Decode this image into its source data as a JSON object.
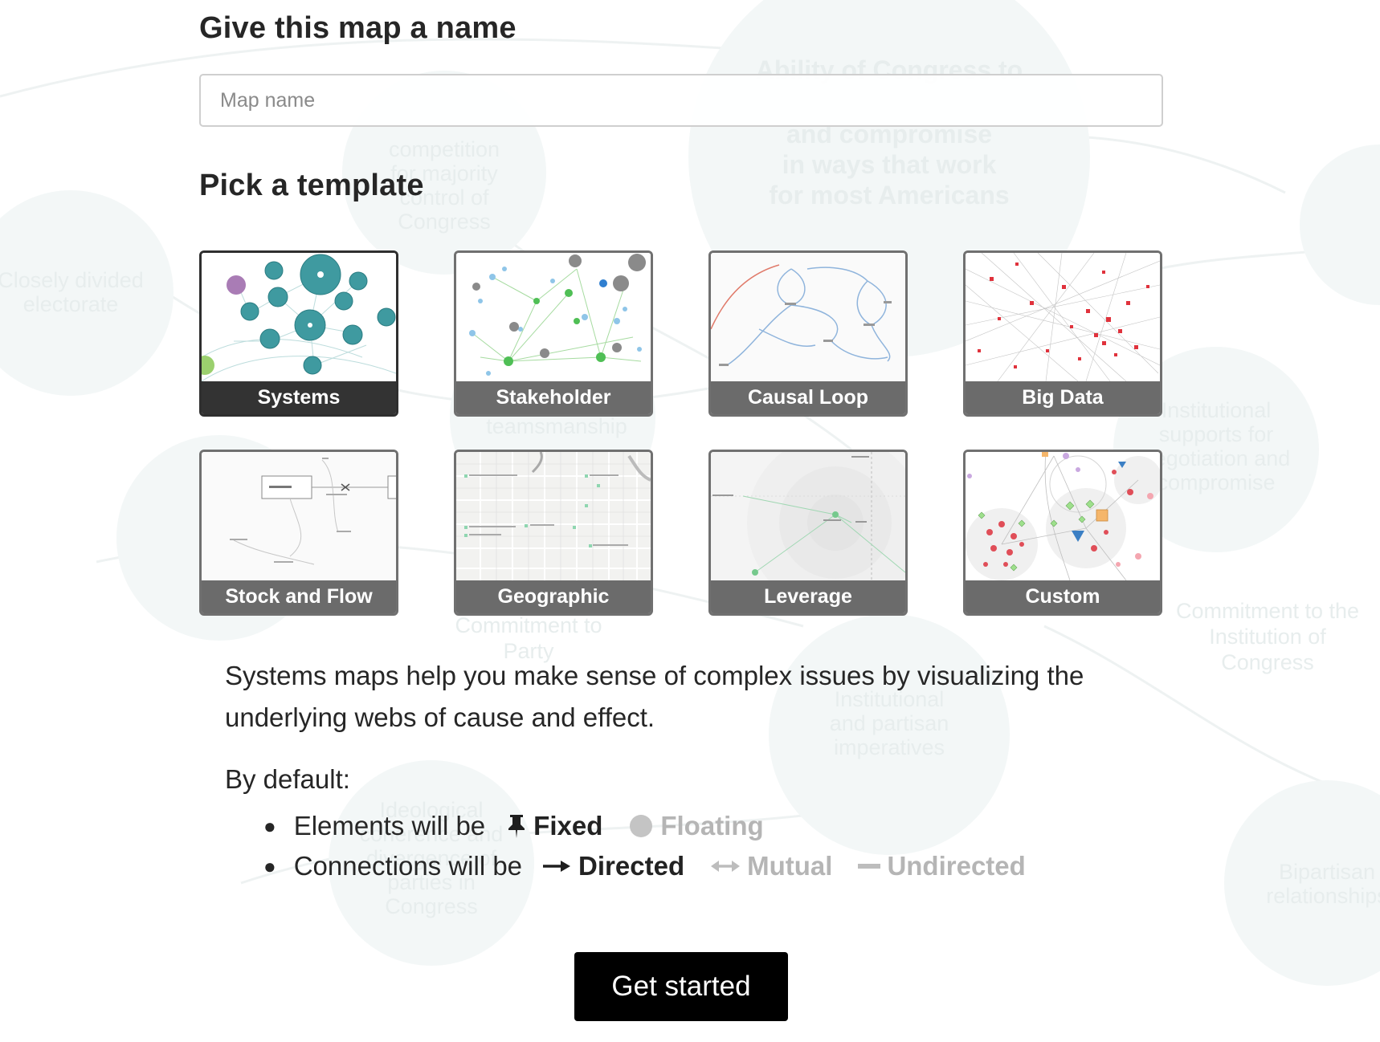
{
  "name_section": {
    "title": "Give this map a name",
    "input_placeholder": "Map name",
    "input_value": ""
  },
  "template_section": {
    "title": "Pick a template",
    "selected": "Systems",
    "templates": [
      {
        "label": "Systems"
      },
      {
        "label": "Stakeholder"
      },
      {
        "label": "Causal Loop"
      },
      {
        "label": "Big Data"
      },
      {
        "label": "Stock and Flow"
      },
      {
        "label": "Geographic"
      },
      {
        "label": "Leverage"
      },
      {
        "label": "Custom"
      }
    ]
  },
  "description": "Systems maps help you make sense of complex issues by visualizing the underlying webs of cause and effect.",
  "defaults": {
    "heading": "By default:",
    "elements": {
      "label": "Elements will be",
      "options": [
        {
          "label": "Fixed",
          "icon": "pin-icon",
          "active": true
        },
        {
          "label": "Floating",
          "icon": "circle-icon",
          "active": false
        }
      ]
    },
    "connections": {
      "label": "Connections will be",
      "options": [
        {
          "label": "Directed",
          "icon": "arrow-right-icon",
          "active": true
        },
        {
          "label": "Mutual",
          "icon": "arrow-both-icon",
          "active": false
        },
        {
          "label": "Undirected",
          "icon": "line-icon",
          "active": false
        }
      ]
    }
  },
  "cta": {
    "label": "Get started"
  },
  "background_map_labels": [
    "Ability of Congress to",
    "and compromise",
    "in ways that work",
    "for most Americans",
    "competition",
    "for majority",
    "control of",
    "Congress",
    "Closely divided",
    "electorate",
    "Institutional",
    "supports for",
    "negotiation and",
    "compromise",
    "Commitment to",
    "Party",
    "Commitment to the",
    "Institution of",
    "Congress",
    "Institutional",
    "and partisan",
    "imperatives",
    "Ideological",
    "coherence and",
    "divergence of",
    "parties in",
    "Congress",
    "Bipartisan",
    "relationships",
    "teamsmanship"
  ],
  "colors": {
    "button_bg": "#000000",
    "label_bg_selected": "#333333",
    "label_bg": "#6b6b6b",
    "inactive_option": "#b5b5b5"
  }
}
